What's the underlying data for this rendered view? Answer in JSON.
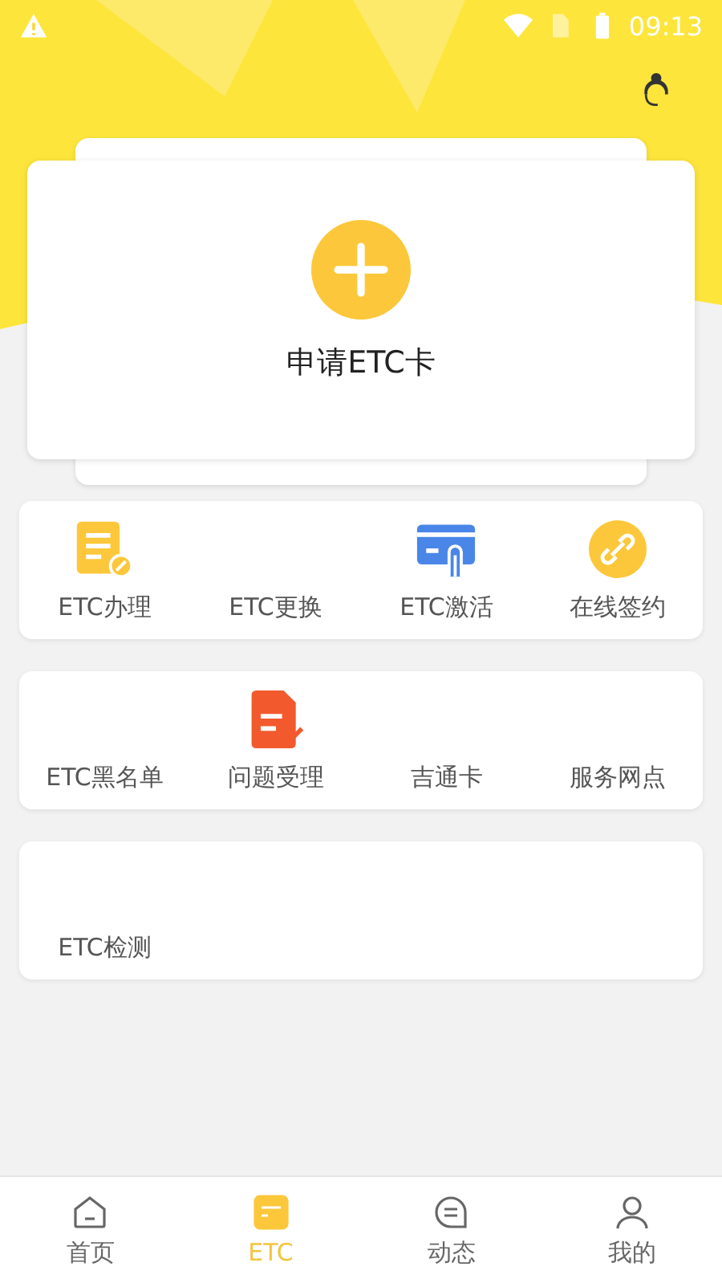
{
  "status_bar": {
    "time": "09:13"
  },
  "apply_card": {
    "label": "申请ETC卡"
  },
  "grids": [
    {
      "items": [
        {
          "label": "ETC办理",
          "kind": "form"
        },
        {
          "label": "ETC更换",
          "kind": "plain"
        },
        {
          "label": "ETC激活",
          "kind": "card"
        },
        {
          "label": "在线签约",
          "kind": "link"
        }
      ]
    },
    {
      "items": [
        {
          "label": "ETC黑名单",
          "kind": "plain"
        },
        {
          "label": "问题受理",
          "kind": "report"
        },
        {
          "label": "吉通卡",
          "kind": "plain"
        },
        {
          "label": "服务网点",
          "kind": "plain"
        }
      ]
    },
    {
      "items": [
        {
          "label": "ETC检测",
          "kind": "plain"
        }
      ]
    }
  ],
  "tabs": [
    {
      "label": "首页",
      "kind": "home",
      "selected": false
    },
    {
      "label": "ETC",
      "kind": "card",
      "selected": true
    },
    {
      "label": "动态",
      "kind": "chat",
      "selected": false
    },
    {
      "label": "我的",
      "kind": "person",
      "selected": false
    }
  ]
}
